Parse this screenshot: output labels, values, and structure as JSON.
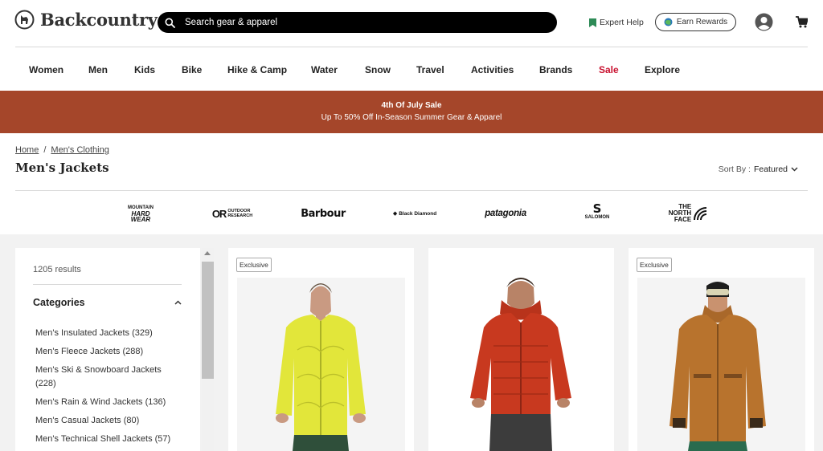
{
  "header": {
    "brand": "Backcountry",
    "search_placeholder": "Search gear & apparel",
    "expert_help": "Expert Help",
    "earn_rewards": "Earn Rewards",
    "icons": [
      "backcountry-goat-logo-icon",
      "search-icon",
      "bookmark-icon",
      "rewards-globe-icon",
      "account-icon",
      "cart-icon"
    ]
  },
  "nav": {
    "items": [
      "Women",
      "Men",
      "Kids",
      "Bike",
      "Hike & Camp",
      "Water",
      "Snow",
      "Travel",
      "Activities",
      "Brands",
      "Sale",
      "Explore"
    ]
  },
  "promo": {
    "title": "4th Of July Sale",
    "subtitle": "Up To 50% Off In-Season Summer Gear & Apparel",
    "color": "#a5462a"
  },
  "breadcrumb": {
    "home": "Home",
    "separator": "/",
    "category": "Men's Clothing"
  },
  "page": {
    "title": "Men's Jackets",
    "sort_label": "Sort By :",
    "sort_value": "Featured"
  },
  "brands": [
    {
      "name": "Mountain Hardwear",
      "lines": [
        "MOUNTAIN",
        "HARD",
        "WEAR"
      ]
    },
    {
      "name": "Outdoor Research",
      "mark": "OR",
      "lines": [
        "OUTDOOR",
        "RESEARCH"
      ]
    },
    {
      "name": "Barbour",
      "text": "Barbour"
    },
    {
      "name": "Black Diamond",
      "text": "Black Diamond"
    },
    {
      "name": "patagonia",
      "text": "patagonia"
    },
    {
      "name": "Salomon",
      "mark": "S",
      "text": "SALOMON"
    },
    {
      "name": "The North Face",
      "lines": [
        "THE",
        "NORTH",
        "FACE"
      ]
    }
  ],
  "filters": {
    "results": "1205 results",
    "categories_title": "Categories",
    "categories": [
      {
        "label": "Men's Insulated Jackets (329)"
      },
      {
        "label": "Men's Fleece Jackets (288)"
      },
      {
        "label": "Men's Ski & Snowboard Jackets (228)"
      },
      {
        "label": "Men's Rain & Wind Jackets (136)"
      },
      {
        "label": "Men's Casual Jackets (80)"
      },
      {
        "label": "Men's Technical Shell Jackets (57)"
      }
    ]
  },
  "products": [
    {
      "badge": "Exclusive",
      "jacket_color": "#e2e63a"
    },
    {
      "badge": "",
      "jacket_color": "#c8391f"
    },
    {
      "badge": "Exclusive",
      "jacket_color": "#b8732d"
    }
  ]
}
